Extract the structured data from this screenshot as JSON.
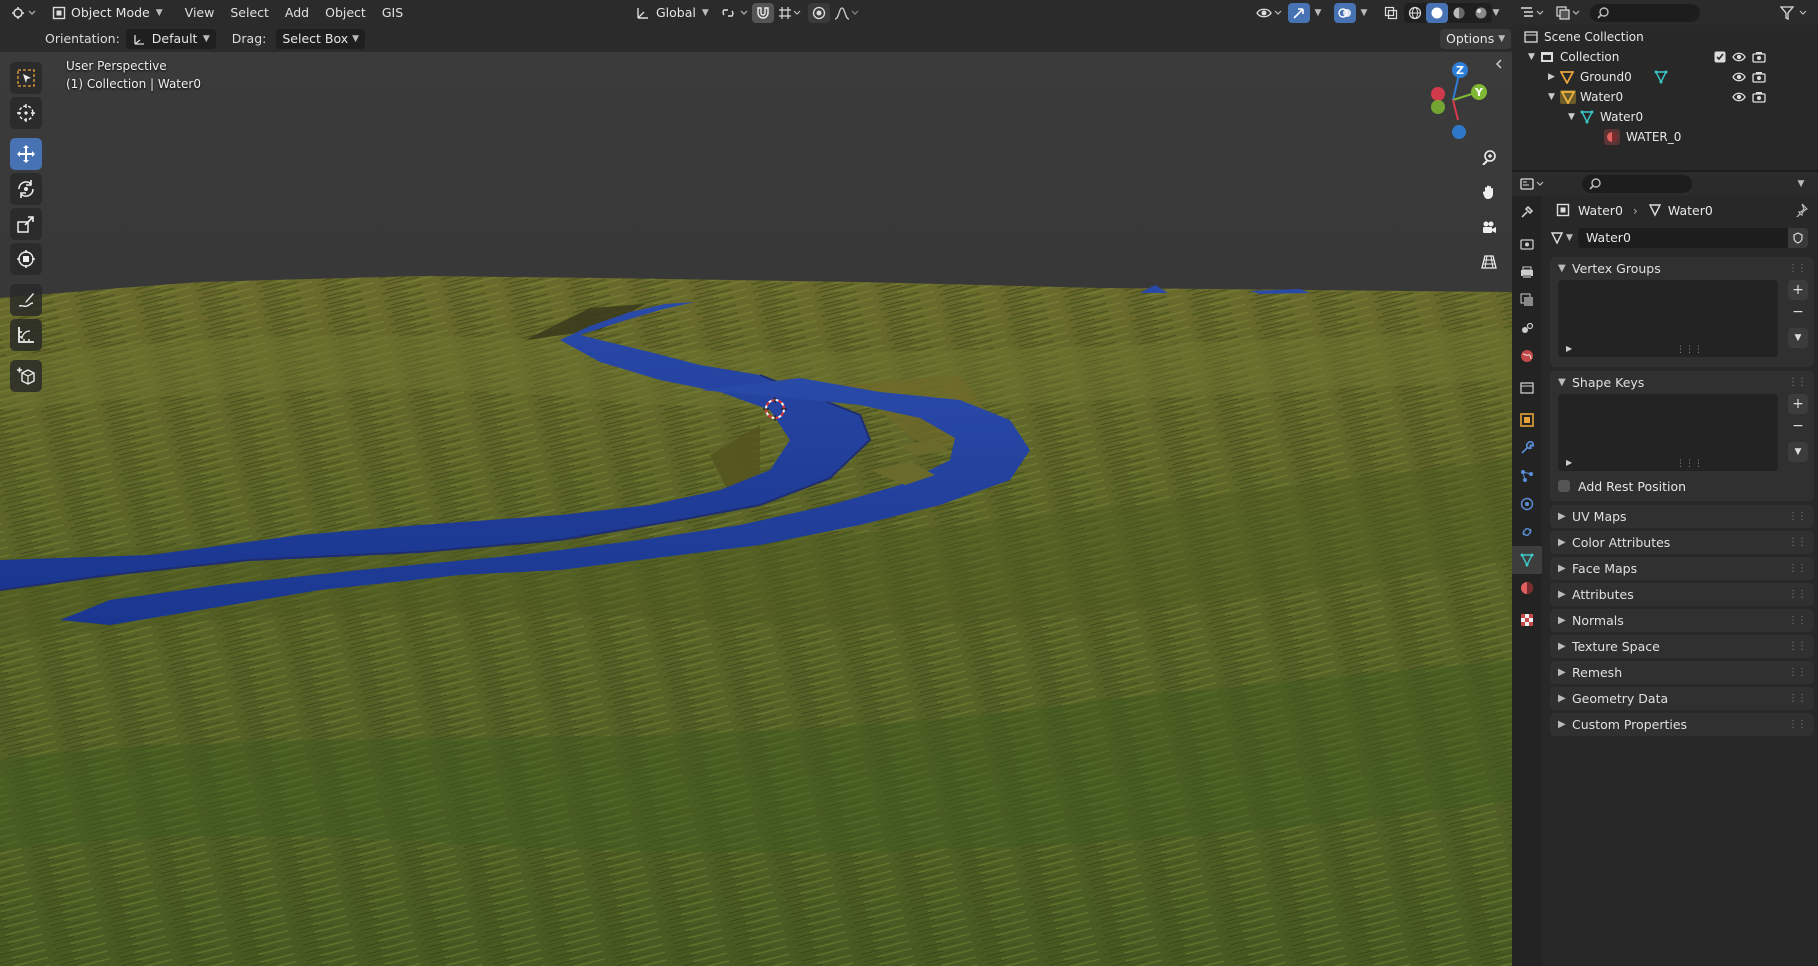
{
  "header": {
    "mode": "Object Mode",
    "menus": [
      "View",
      "Select",
      "Add",
      "Object",
      "GIS"
    ],
    "transform_orientation": "Global"
  },
  "tool_options": {
    "orientation_label": "Orientation:",
    "orientation_value": "Default",
    "drag_label": "Drag:",
    "drag_value": "Select Box",
    "options_label": "Options"
  },
  "viewport": {
    "view_name": "User Perspective",
    "collection_info": "(1) Collection | Water0",
    "gizmo": {
      "z": "Z",
      "y": "Y"
    }
  },
  "outliner": {
    "scene_collection": "Scene Collection",
    "collection": "Collection",
    "items": [
      "Ground0",
      "Water0",
      "Water0",
      "WATER_0"
    ]
  },
  "properties": {
    "breadcrumb_object": "Water0",
    "breadcrumb_data": "Water0",
    "mesh_name": "Water0",
    "panels": {
      "vertex_groups": "Vertex Groups",
      "shape_keys": "Shape Keys",
      "add_rest_position": "Add Rest Position"
    },
    "collapsed_panels": [
      "UV Maps",
      "Color Attributes",
      "Face Maps",
      "Attributes",
      "Normals",
      "Texture Space",
      "Remesh",
      "Geometry Data",
      "Custom Properties"
    ]
  },
  "colors": {
    "accent": "#4772b3",
    "water": "#1f3f9a",
    "grass": "#5d6428",
    "panel_bg": "#303030"
  }
}
